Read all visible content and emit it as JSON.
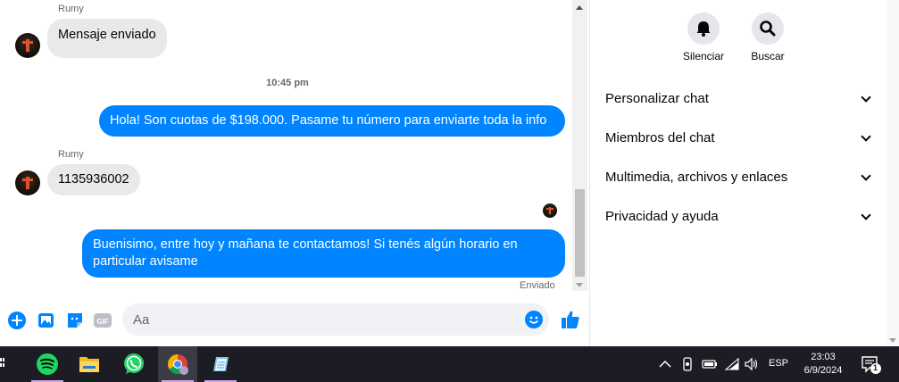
{
  "chat": {
    "messages": [
      {
        "sender": "Rumy",
        "text": "Mensaje enviado"
      },
      {
        "timestamp": "10:45 pm"
      },
      {
        "text": "Hola! Son cuotas de $198.000. Pasame tu número para enviarte toda la info"
      },
      {
        "sender": "Rumy",
        "text": "1135936002"
      },
      {
        "text_line1": "Buenisimo, entre hoy y mañana te contactamos! Si tenés algún horario en",
        "text_line2": "particular avisame",
        "status": "Enviado"
      }
    ],
    "composer": {
      "placeholder": "Aa"
    }
  },
  "side": {
    "actions": {
      "mute_label": "Silenciar",
      "search_label": "Buscar"
    },
    "sections": [
      "Personalizar chat",
      "Miembros del chat",
      "Multimedia, archivos y enlaces",
      "Privacidad y ayuda"
    ]
  },
  "taskbar": {
    "apps": [
      "spotify",
      "file-explorer",
      "whatsapp",
      "chrome",
      "notepad"
    ],
    "language": "ESP",
    "time": "23:03",
    "date": "6/9/2024",
    "notification_count": "1"
  },
  "colors": {
    "accent": "#0084ff",
    "bubble_in": "#e9e9eb",
    "taskbar": "#1c1c24"
  }
}
